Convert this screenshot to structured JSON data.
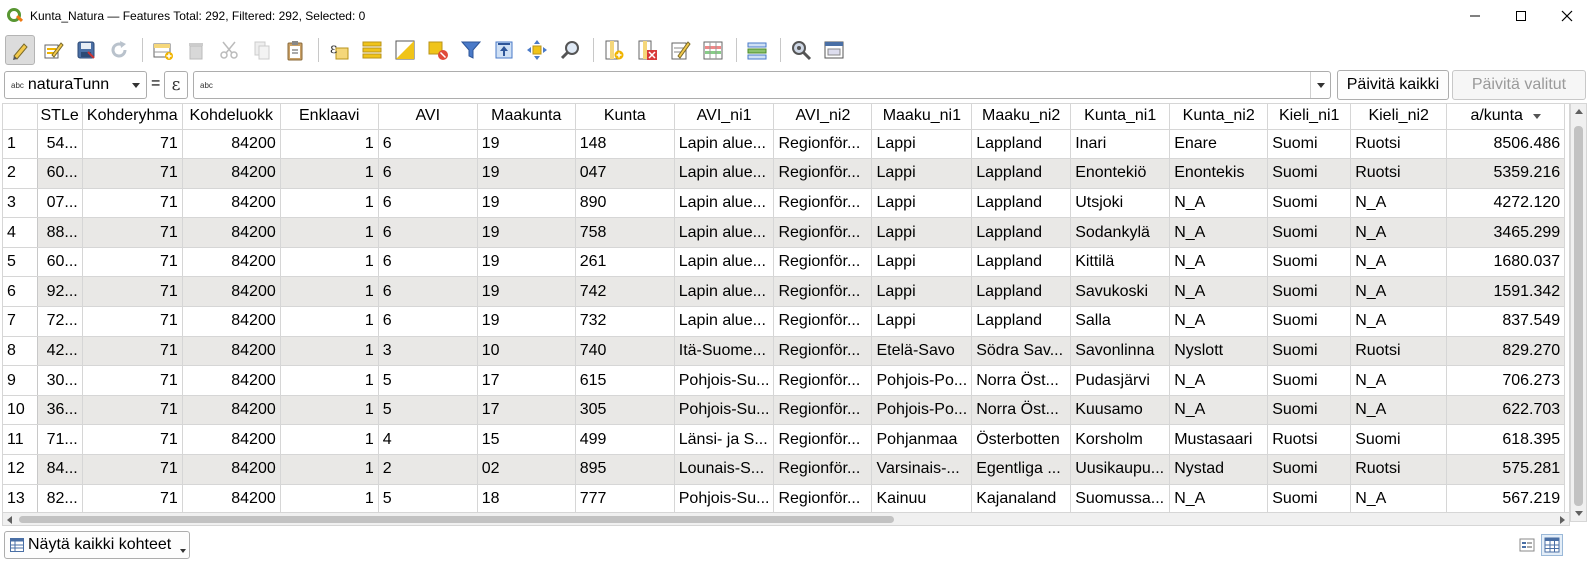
{
  "window": {
    "title": "Kunta_Natura — Features Total: 292, Filtered: 292, Selected: 0",
    "app_icon": "qgis-logo-icon",
    "controls": [
      "minimize-icon",
      "maximize-icon",
      "close-icon"
    ]
  },
  "toolbar": {
    "buttons": [
      {
        "name": "toggle-editing-button",
        "icon": "pencil-icon",
        "active": true
      },
      {
        "name": "multi-edit-button",
        "icon": "multi-edit-icon"
      },
      {
        "name": "save-edits-button",
        "icon": "save-icon"
      },
      {
        "name": "reload-table-button",
        "icon": "reload-icon"
      },
      {
        "name": "add-feature-button",
        "icon": "add-feature-icon"
      },
      {
        "name": "delete-features-button",
        "icon": "trash-icon"
      },
      {
        "name": "cut-button",
        "icon": "scissors-icon"
      },
      {
        "name": "copy-button",
        "icon": "copy-icon"
      },
      {
        "name": "paste-button",
        "icon": "clipboard-icon"
      },
      {
        "name": "select-by-expression-button",
        "icon": "expression-select-icon"
      },
      {
        "name": "select-all-button",
        "icon": "select-all-icon"
      },
      {
        "name": "invert-selection-button",
        "icon": "invert-selection-icon"
      },
      {
        "name": "deselect-all-button",
        "icon": "deselect-icon"
      },
      {
        "name": "filter-select-button",
        "icon": "filter-icon"
      },
      {
        "name": "move-selection-to-top-button",
        "icon": "move-to-top-icon"
      },
      {
        "name": "pan-to-selected-button",
        "icon": "pan-icon"
      },
      {
        "name": "zoom-to-selected-button",
        "icon": "zoom-icon"
      },
      {
        "name": "new-field-button",
        "icon": "new-field-icon"
      },
      {
        "name": "delete-field-button",
        "icon": "delete-field-icon"
      },
      {
        "name": "field-calculator-button",
        "icon": "field-calculator-icon"
      },
      {
        "name": "conditional-formatting-button",
        "icon": "conditional-format-icon"
      },
      {
        "name": "actions-button",
        "icon": "actions-icon"
      },
      {
        "name": "zoom-map-button",
        "icon": "search-gear-icon"
      },
      {
        "name": "dock-table-button",
        "icon": "dock-icon"
      }
    ]
  },
  "expression_bar": {
    "field_type": "abc",
    "field": "naturaTunn",
    "equals": "=",
    "epsilon": "ε",
    "input_type": "abc",
    "input_value": "",
    "update_all": "Päivitä kaikki",
    "update_selected": "Päivitä valitut"
  },
  "table": {
    "columns": [
      "STLe",
      "Kohderyhma",
      "Kohdeluokk",
      "Enklaavi",
      "AVI",
      "Maakunta",
      "Kunta",
      "AVI_ni1",
      "AVI_ni2",
      "Maaku_ni1",
      "Maaku_ni2",
      "Kunta_ni1",
      "Kunta_ni2",
      "Kieli_ni1",
      "Kieli_ni2",
      "a/kunta"
    ],
    "sorted_column": "a/kunta",
    "rows": [
      {
        "n": "1",
        "cells": [
          "54...",
          "71",
          "84200",
          "1",
          "6",
          "19",
          "148",
          "Lapin alue...",
          "Regionför...",
          "Lappi",
          "Lappland",
          "Inari",
          "Enare",
          "Suomi",
          "Ruotsi",
          "8506.486"
        ]
      },
      {
        "n": "2",
        "cells": [
          "60...",
          "71",
          "84200",
          "1",
          "6",
          "19",
          "047",
          "Lapin alue...",
          "Regionför...",
          "Lappi",
          "Lappland",
          "Enontekiö",
          "Enontekis",
          "Suomi",
          "Ruotsi",
          "5359.216"
        ]
      },
      {
        "n": "3",
        "cells": [
          "07...",
          "71",
          "84200",
          "1",
          "6",
          "19",
          "890",
          "Lapin alue...",
          "Regionför...",
          "Lappi",
          "Lappland",
          "Utsjoki",
          "N_A",
          "Suomi",
          "N_A",
          "4272.120"
        ]
      },
      {
        "n": "4",
        "cells": [
          "88...",
          "71",
          "84200",
          "1",
          "6",
          "19",
          "758",
          "Lapin alue...",
          "Regionför...",
          "Lappi",
          "Lappland",
          "Sodankylä",
          "N_A",
          "Suomi",
          "N_A",
          "3465.299"
        ]
      },
      {
        "n": "5",
        "cells": [
          "60...",
          "71",
          "84200",
          "1",
          "6",
          "19",
          "261",
          "Lapin alue...",
          "Regionför...",
          "Lappi",
          "Lappland",
          "Kittilä",
          "N_A",
          "Suomi",
          "N_A",
          "1680.037"
        ]
      },
      {
        "n": "6",
        "cells": [
          "92...",
          "71",
          "84200",
          "1",
          "6",
          "19",
          "742",
          "Lapin alue...",
          "Regionför...",
          "Lappi",
          "Lappland",
          "Savukoski",
          "N_A",
          "Suomi",
          "N_A",
          "1591.342"
        ]
      },
      {
        "n": "7",
        "cells": [
          "72...",
          "71",
          "84200",
          "1",
          "6",
          "19",
          "732",
          "Lapin alue...",
          "Regionför...",
          "Lappi",
          "Lappland",
          "Salla",
          "N_A",
          "Suomi",
          "N_A",
          "837.549"
        ]
      },
      {
        "n": "8",
        "cells": [
          "42...",
          "71",
          "84200",
          "1",
          "3",
          "10",
          "740",
          "Itä-Suome...",
          "Regionför...",
          "Etelä-Savo",
          "Södra Sav...",
          "Savonlinna",
          "Nyslott",
          "Suomi",
          "Ruotsi",
          "829.270"
        ]
      },
      {
        "n": "9",
        "cells": [
          "30...",
          "71",
          "84200",
          "1",
          "5",
          "17",
          "615",
          "Pohjois-Su...",
          "Regionför...",
          "Pohjois-Po...",
          "Norra Öst...",
          "Pudasjärvi",
          "N_A",
          "Suomi",
          "N_A",
          "706.273"
        ]
      },
      {
        "n": "10",
        "cells": [
          "36...",
          "71",
          "84200",
          "1",
          "5",
          "17",
          "305",
          "Pohjois-Su...",
          "Regionför...",
          "Pohjois-Po...",
          "Norra Öst...",
          "Kuusamo",
          "N_A",
          "Suomi",
          "N_A",
          "622.703"
        ]
      },
      {
        "n": "11",
        "cells": [
          "71...",
          "71",
          "84200",
          "1",
          "4",
          "15",
          "499",
          "Länsi- ja S...",
          "Regionför...",
          "Pohjanmaa",
          "Österbotten",
          "Korsholm",
          "Mustasaari",
          "Ruotsi",
          "Suomi",
          "618.395"
        ]
      },
      {
        "n": "12",
        "cells": [
          "84...",
          "71",
          "84200",
          "1",
          "2",
          "02",
          "895",
          "Lounais-S...",
          "Regionför...",
          "Varsinais-...",
          "Egentliga ...",
          "Uusikaupu...",
          "Nystad",
          "Suomi",
          "Ruotsi",
          "575.281"
        ]
      },
      {
        "n": "13",
        "cells": [
          "82...",
          "71",
          "84200",
          "1",
          "5",
          "18",
          "777",
          "Pohjois-Su...",
          "Regionför...",
          "Kainuu",
          "Kajanaland",
          "Suomussa...",
          "N_A",
          "Suomi",
          "N_A",
          "567.219"
        ]
      }
    ]
  },
  "bottom": {
    "show_all": "Näytä kaikki kohteet",
    "show_all_icon": "table-icon",
    "views": [
      "form-view-icon",
      "table-view-icon"
    ]
  },
  "colors": {
    "alt_row": "#e9e8e6",
    "grid_line": "#d6d6d6",
    "qgis_green": "#589632",
    "qgis_orange": "#ee7913"
  }
}
